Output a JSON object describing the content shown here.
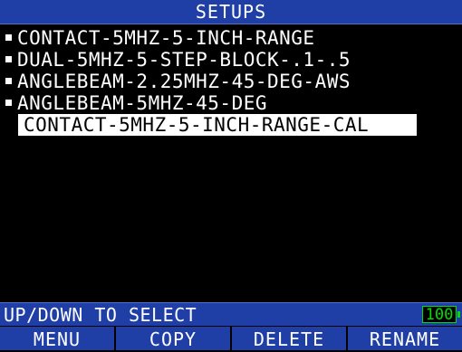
{
  "header": {
    "title": "SETUPS"
  },
  "setups": {
    "items": [
      {
        "label": "CONTACT-5MHZ-5-INCH-RANGE"
      },
      {
        "label": "DUAL-5MHZ-5-STEP-BLOCK-.1-.5"
      },
      {
        "label": "ANGLEBEAM-2.25MHZ-45-DEG-AWS"
      },
      {
        "label": "ANGLEBEAM-5MHZ-45-DEG"
      }
    ],
    "selected": {
      "label": "CONTACT-5MHZ-5-INCH-RANGE-CAL"
    }
  },
  "status": {
    "instruction": "UP/DOWN TO SELECT",
    "battery": "100"
  },
  "softkeys": {
    "menu": "MENU",
    "copy": "COPY",
    "delete": "DELETE",
    "rename": "RENAME"
  },
  "colors": {
    "bar_background": "#1f3fa6",
    "screen_background": "#000000",
    "battery": "#00e000",
    "selection_background": "#ffffff"
  }
}
